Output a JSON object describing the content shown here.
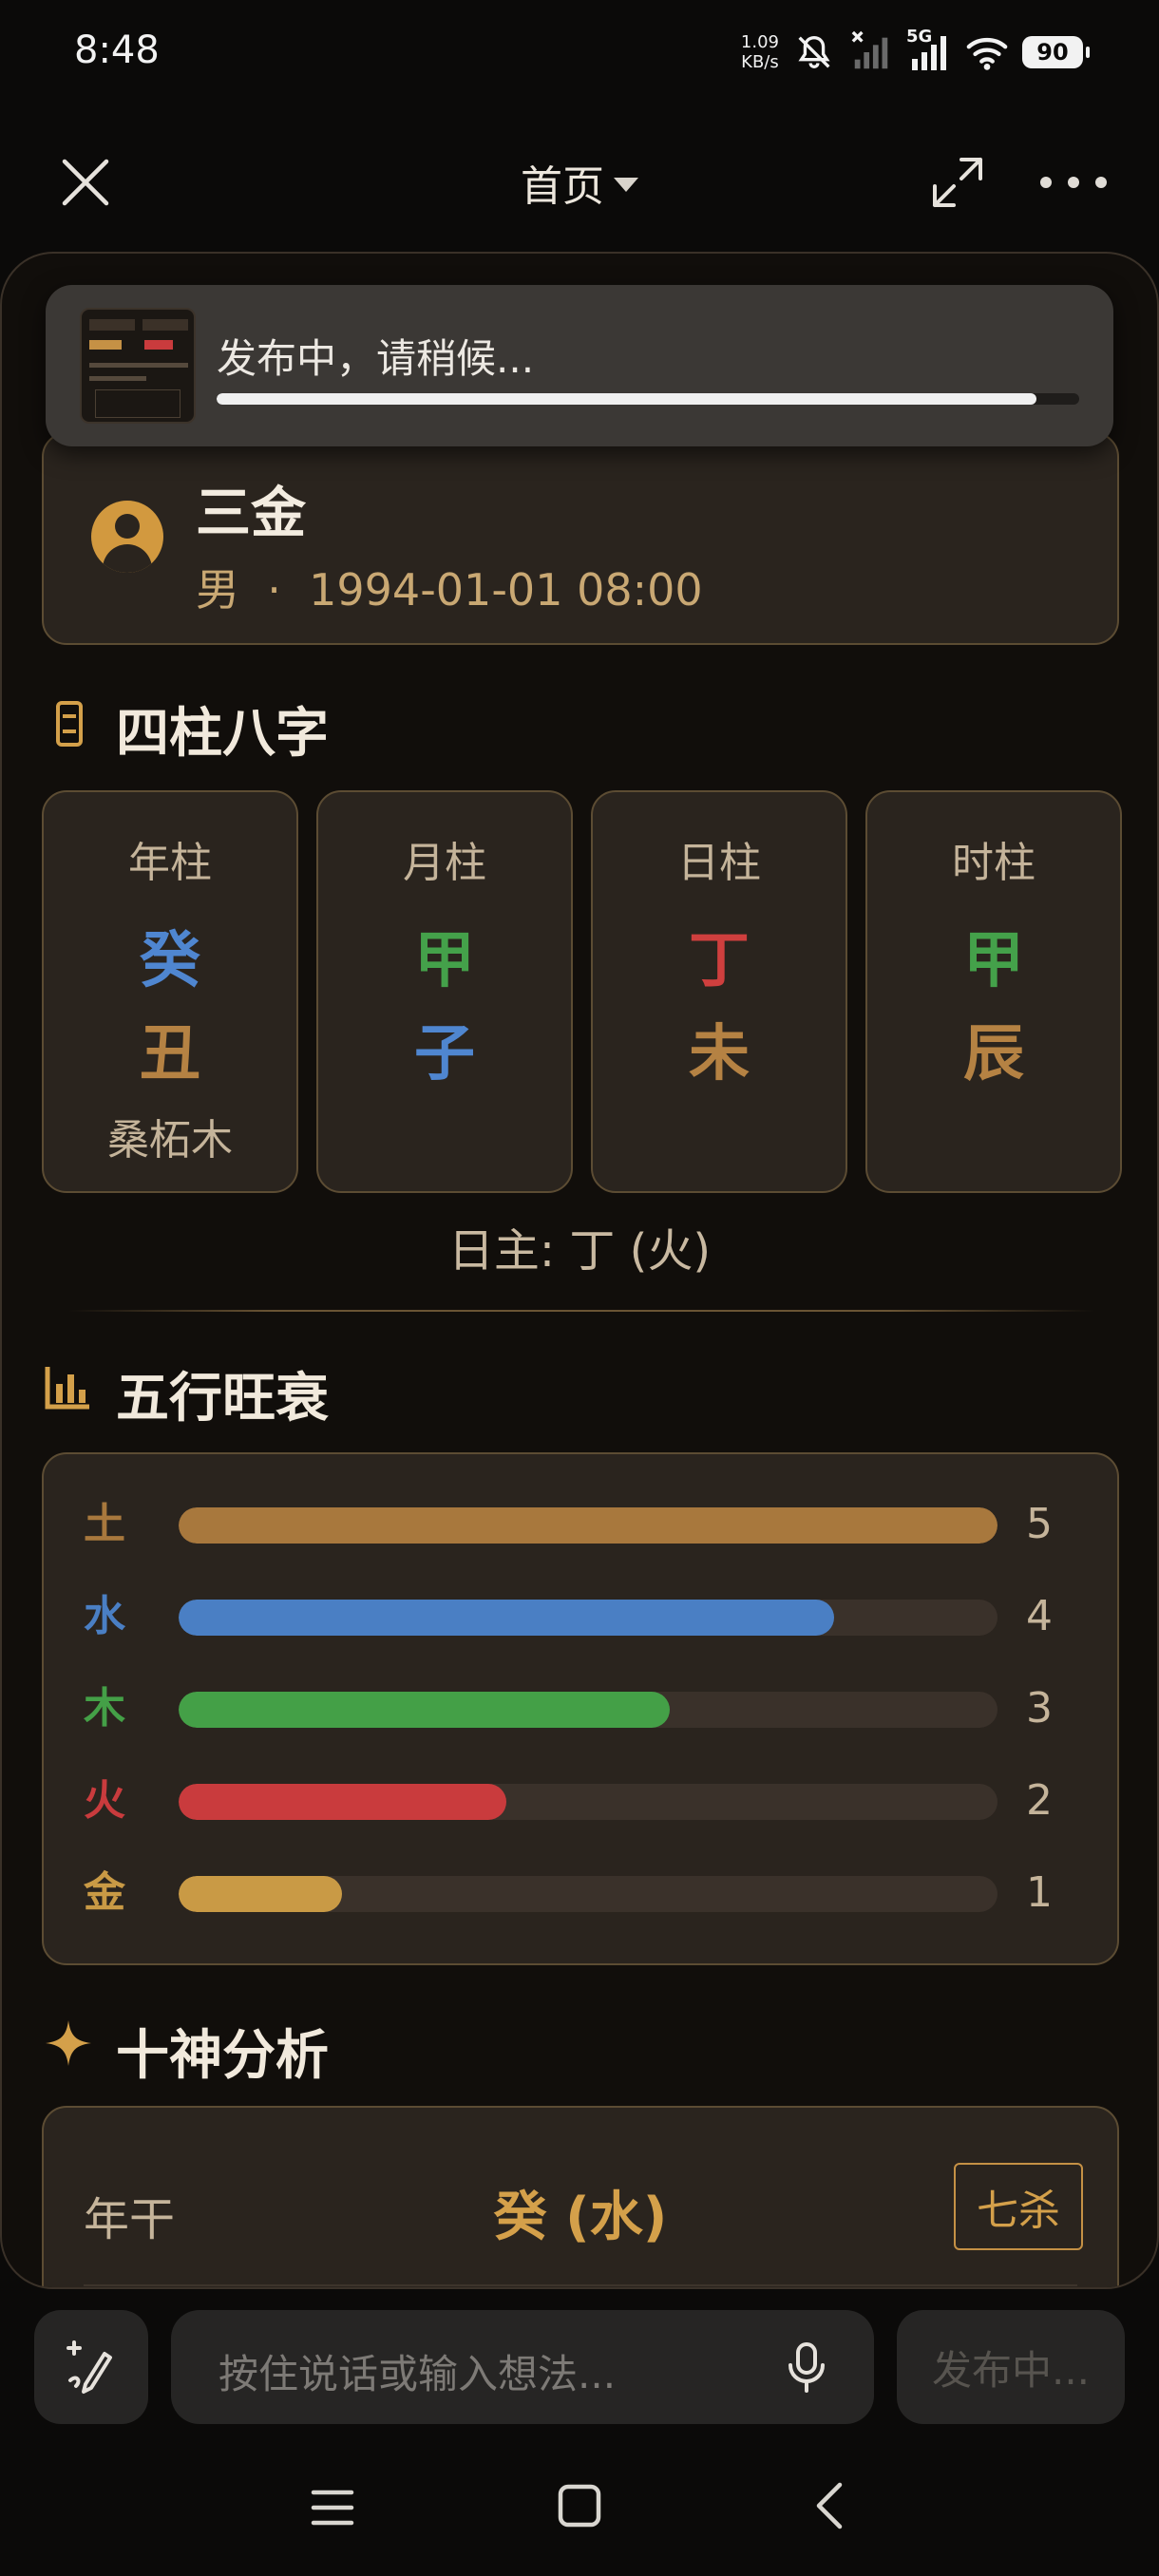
{
  "status_bar": {
    "time": "8:48",
    "net_speed_value": "1.09",
    "net_speed_unit": "KB/s",
    "network": "5G",
    "battery": "90"
  },
  "nav": {
    "title": "首页",
    "close_icon": "close-icon",
    "expand_icon": "expand-icon",
    "more_icon": "more-icon"
  },
  "profile": {
    "name": "三金",
    "gender": "男",
    "separator": "·",
    "birth": "1994-01-01 08:00"
  },
  "bazi": {
    "title": "四柱八字",
    "pillars": [
      {
        "label": "年柱",
        "stem": "癸",
        "stem_color": "#4f86d0",
        "branch": "丑",
        "branch_color": "#b58243",
        "nayin": "桑柘木"
      },
      {
        "label": "月柱",
        "stem": "甲",
        "stem_color": "#44a14a",
        "branch": "子",
        "branch_color": "#4f86d0",
        "nayin": ""
      },
      {
        "label": "日柱",
        "stem": "丁",
        "stem_color": "#cf3f3e",
        "branch": "未",
        "branch_color": "#b58243",
        "nayin": ""
      },
      {
        "label": "时柱",
        "stem": "甲",
        "stem_color": "#44a14a",
        "branch": "辰",
        "branch_color": "#b58243",
        "nayin": ""
      }
    ],
    "day_master": "日主: 丁 (火)"
  },
  "wuxing": {
    "title": "五行旺衰",
    "max": 5,
    "items": [
      {
        "label": "土",
        "count": "5",
        "value": 5,
        "color": "#a8783d"
      },
      {
        "label": "水",
        "count": "4",
        "value": 4,
        "color": "#4a7fc4"
      },
      {
        "label": "木",
        "count": "3",
        "value": 3,
        "color": "#44a047"
      },
      {
        "label": "火",
        "count": "2",
        "value": 2,
        "color": "#c93b3d"
      },
      {
        "label": "金",
        "count": "1",
        "value": 1,
        "color": "#c99a45"
      }
    ]
  },
  "shishen": {
    "title": "十神分析",
    "rows": [
      {
        "label": "年干",
        "value": "癸 (水)",
        "tag": "七杀"
      }
    ]
  },
  "toast": {
    "text": "发布中，请稍候...",
    "progress": 0.95
  },
  "input_bar": {
    "placeholder": "按住说话或输入想法...",
    "publish_label": "发布中..."
  },
  "colors": {
    "accent": "#d4a04a",
    "card_bg": "#2a241e",
    "card_border": "#5c4c33"
  }
}
